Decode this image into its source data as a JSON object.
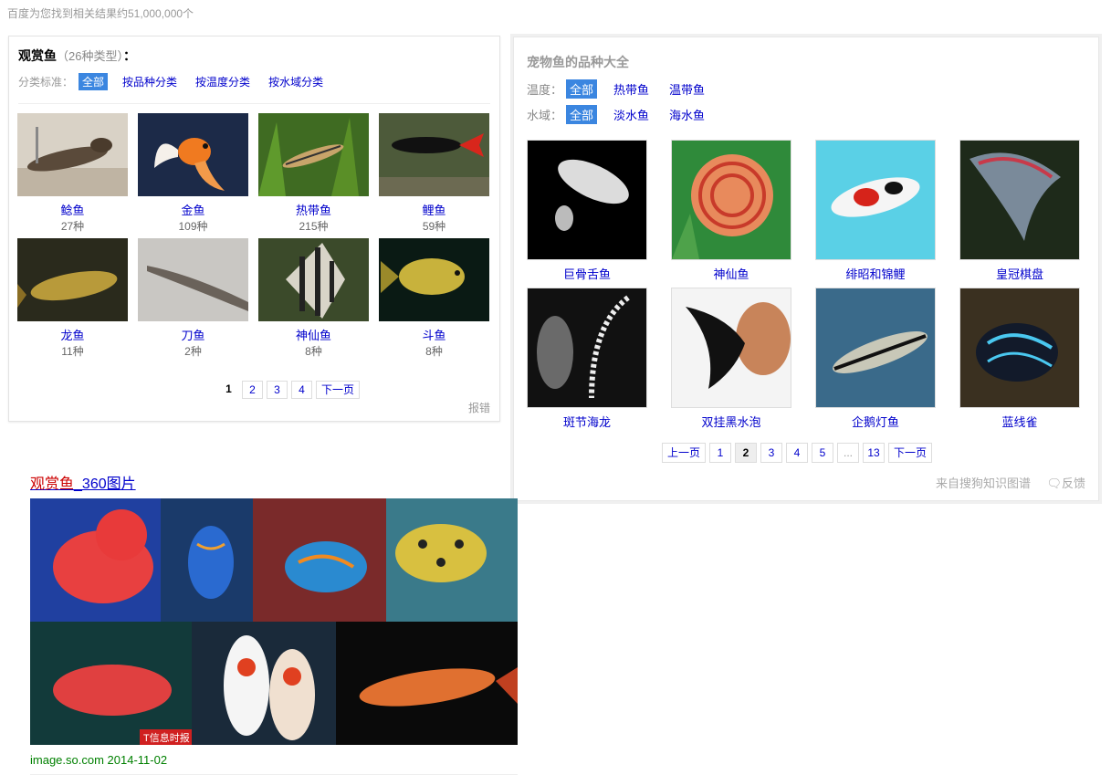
{
  "result_count": "百度为您找到相关结果约51,000,000个",
  "left_card": {
    "title": "观赏鱼",
    "subtitle": "（26种类型）",
    "colon": "：",
    "filter_label": "分类标准：",
    "filters": [
      "全部",
      "按品种分类",
      "按温度分类",
      "按水域分类"
    ],
    "items": [
      {
        "name": "鲶鱼",
        "count": "27种"
      },
      {
        "name": "金鱼",
        "count": "109种"
      },
      {
        "name": "热带鱼",
        "count": "215种"
      },
      {
        "name": "鲤鱼",
        "count": "59种"
      },
      {
        "name": "龙鱼",
        "count": "11种"
      },
      {
        "name": "刀鱼",
        "count": "2种"
      },
      {
        "name": "神仙鱼",
        "count": "8种"
      },
      {
        "name": "斗鱼",
        "count": "8种"
      }
    ],
    "pager": [
      "1",
      "2",
      "3",
      "4",
      "下一页"
    ],
    "report": "报错"
  },
  "right_card": {
    "title": "宠物鱼的品种大全",
    "temp_label": "温度：",
    "temp_filters": [
      "全部",
      "热带鱼",
      "温带鱼"
    ],
    "water_label": "水域：",
    "water_filters": [
      "全部",
      "淡水鱼",
      "海水鱼"
    ],
    "items": [
      "巨骨舌鱼",
      "神仙鱼",
      "绯昭和锦鲤",
      "皇冠棋盘",
      "斑节海龙",
      "双挂黑水泡",
      "企鹅灯鱼",
      "蓝线雀"
    ],
    "pager": [
      "上一页",
      "1",
      "2",
      "3",
      "4",
      "5",
      "...",
      "13",
      "下一页"
    ],
    "source": "来自搜狗知识图谱",
    "feedback": "反馈"
  },
  "result": {
    "title_highlight": "观赏鱼",
    "title_rest": "_360图片",
    "url": "image.so.com",
    "date": "2014-11-02",
    "watermark": "T信息时报"
  }
}
